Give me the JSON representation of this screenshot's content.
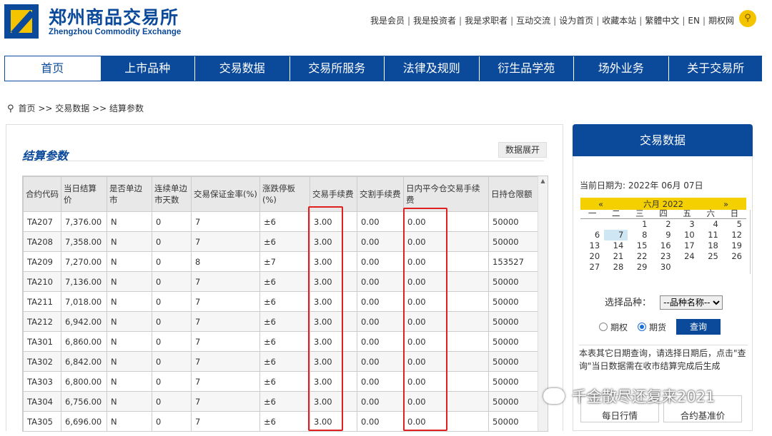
{
  "header": {
    "title_cn": "郑州商品交易所",
    "title_en": "Zhengzhou Commodity Exchange",
    "top_links": [
      "我是会员",
      "我是投资者",
      "我是求职者",
      "互动交流",
      "设为首页",
      "收藏本站",
      "繁體中文",
      "EN",
      "期权网"
    ],
    "search_icon": "search-icon"
  },
  "nav": [
    "首页",
    "上市品种",
    "交易数据",
    "交易所服务",
    "法律及规则",
    "衍生品学苑",
    "场外业务",
    "关于交易所"
  ],
  "breadcrumb": "首页 >> 交易数据 >> 结算参数",
  "section": {
    "title": "结算参数",
    "expand_label": "数据展开"
  },
  "table": {
    "headers": [
      "合约代码",
      "当日结算价",
      "是否单边市",
      "连续单边市天数",
      "交易保证金率(%)",
      "涨跌停板(%)",
      "交易手续费",
      "交割手续费",
      "日内平今仓交易手续费",
      "日持仓限额"
    ],
    "rows": [
      [
        "TA207",
        "7,376.00",
        "N",
        "0",
        "7",
        "±6",
        "3.00",
        "0.00",
        "0.00",
        "50000"
      ],
      [
        "TA208",
        "7,358.00",
        "N",
        "0",
        "7",
        "±6",
        "3.00",
        "0.00",
        "0.00",
        "50000"
      ],
      [
        "TA209",
        "7,270.00",
        "N",
        "0",
        "8",
        "±7",
        "3.00",
        "0.00",
        "0.00",
        "153527"
      ],
      [
        "TA210",
        "7,136.00",
        "N",
        "0",
        "7",
        "±6",
        "3.00",
        "0.00",
        "0.00",
        "50000"
      ],
      [
        "TA211",
        "7,018.00",
        "N",
        "0",
        "7",
        "±6",
        "3.00",
        "0.00",
        "0.00",
        "50000"
      ],
      [
        "TA212",
        "6,942.00",
        "N",
        "0",
        "7",
        "±6",
        "3.00",
        "0.00",
        "0.00",
        "50000"
      ],
      [
        "TA301",
        "6,860.00",
        "N",
        "0",
        "7",
        "±6",
        "3.00",
        "0.00",
        "0.00",
        "50000"
      ],
      [
        "TA302",
        "6,842.00",
        "N",
        "0",
        "7",
        "±6",
        "3.00",
        "0.00",
        "0.00",
        "50000"
      ],
      [
        "TA303",
        "6,800.00",
        "N",
        "0",
        "7",
        "±6",
        "3.00",
        "0.00",
        "0.00",
        "50000"
      ],
      [
        "TA304",
        "6,756.00",
        "N",
        "0",
        "7",
        "±6",
        "3.00",
        "0.00",
        "0.00",
        "50000"
      ],
      [
        "TA305",
        "6,696.00",
        "N",
        "0",
        "7",
        "±6",
        "3.00",
        "0.00",
        "0.00",
        "50000"
      ]
    ]
  },
  "sidebar": {
    "title": "交易数据",
    "current_date": "当前日期为: 2022年 06月 07日",
    "calendar": {
      "prev": "«",
      "month_label": "六月 2022",
      "next": "»",
      "weekdays": [
        "一",
        "二",
        "三",
        "四",
        "五",
        "六",
        "日"
      ],
      "weeks": [
        [
          "",
          "",
          "1",
          "2",
          "3",
          "4",
          "5"
        ],
        [
          "6",
          "7",
          "8",
          "9",
          "10",
          "11",
          "12"
        ],
        [
          "13",
          "14",
          "15",
          "16",
          "17",
          "18",
          "19"
        ],
        [
          "20",
          "21",
          "22",
          "23",
          "24",
          "25",
          "26"
        ],
        [
          "27",
          "28",
          "29",
          "30",
          "",
          "",
          ""
        ]
      ],
      "selected": "7"
    },
    "select_label": "选择品种：",
    "select_value": "--品种名称--",
    "radio_options": [
      "期权",
      "期货"
    ],
    "radio_selected": "期货",
    "query_label": "查询",
    "note": "本表其它日期查询，请选择日期后，点击\"查询\"当日数据需在收市结算完成后生成",
    "buttons": [
      "每日行情",
      "合约基准价"
    ]
  },
  "watermark": "千金散尽还复来2021",
  "colors": {
    "brand_blue": "#0b4a9a",
    "brand_yellow": "#f5c400",
    "highlight_red": "#e02020"
  }
}
